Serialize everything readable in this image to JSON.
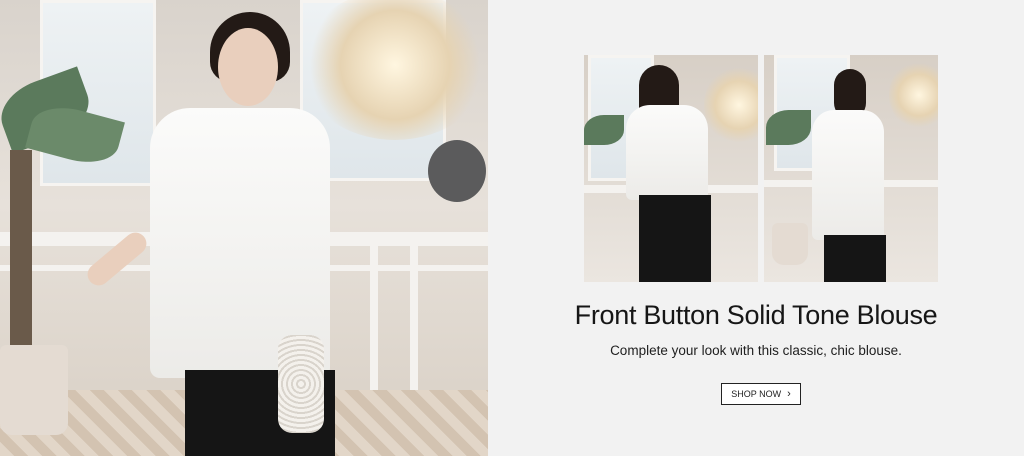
{
  "banner": {
    "title": "Front Button Solid Tone Blouse",
    "subtitle": "Complete your look with this classic, chic blouse.",
    "cta_label": "SHOP NOW",
    "cta_icon": "chevron-right-icon"
  },
  "images": {
    "hero": "model-front-view-photo",
    "thumbnails": [
      "model-back-view-photo",
      "model-side-view-photo"
    ]
  },
  "colors": {
    "background": "#f2f2f2",
    "title": "#161616",
    "button_border": "#222222"
  }
}
